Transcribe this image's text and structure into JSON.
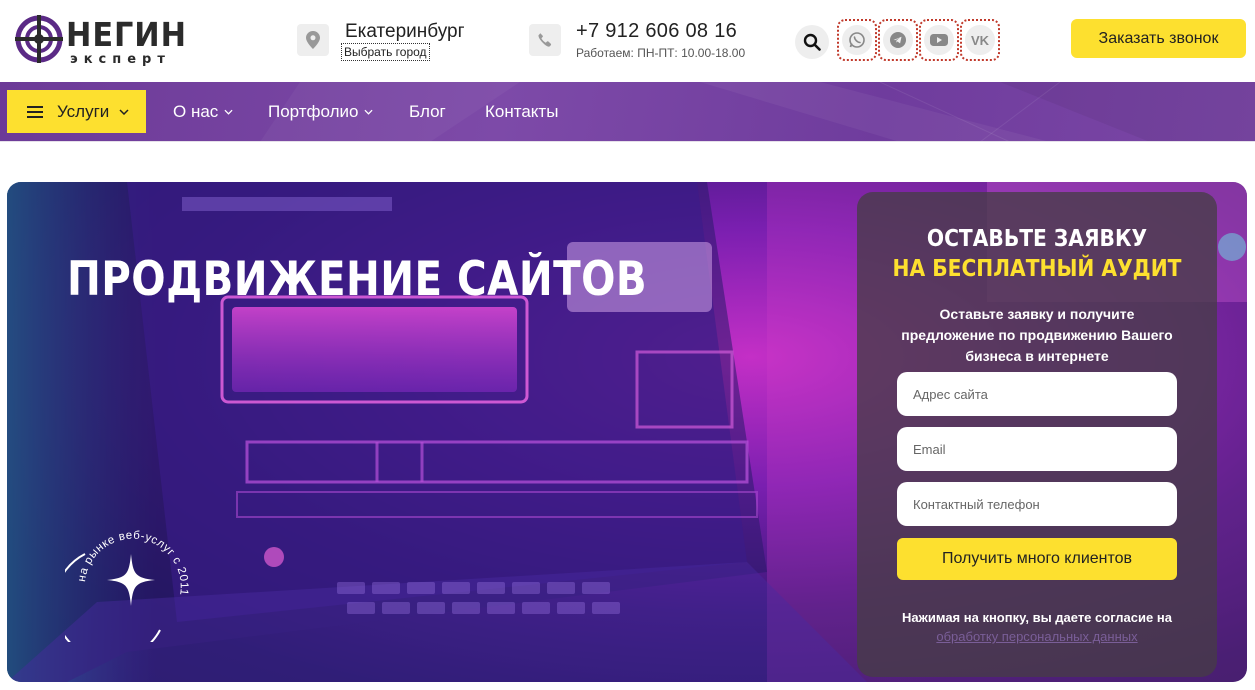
{
  "logo": {
    "word": "НЕГИН",
    "sub": "эксперт"
  },
  "location": {
    "city": "Екатеринбург",
    "change_label": "Выбрать город",
    "icon": "map-pin-icon"
  },
  "contact": {
    "phone": "+7 912 606 08 16",
    "hours": "Работаем: ПН-ПТ: 10.00-18.00",
    "icon": "phone-icon"
  },
  "socials": [
    "whatsapp-icon",
    "telegram-icon",
    "youtube-icon",
    "vk-icon"
  ],
  "callback_label": "Заказать звонок",
  "nav": {
    "services_label": "Услуги",
    "items": [
      {
        "label": "О нас",
        "has_dropdown": true
      },
      {
        "label": "Портфолио",
        "has_dropdown": true
      },
      {
        "label": "Блог",
        "has_dropdown": false
      },
      {
        "label": "Контакты",
        "has_dropdown": false
      }
    ]
  },
  "hero": {
    "title": "ПРОДВИЖЕНИЕ САЙТОВ",
    "badge_text": "на рынке веб-услуг с 2011"
  },
  "form": {
    "title_line1": "ОСТАВЬТЕ ЗАЯВКУ",
    "title_line2": "НА БЕСПЛАТНЫЙ АУДИТ",
    "description": "Оставьте заявку и получите предложение по продвижению Вашего бизнеса в интернете",
    "site_placeholder": "Адрес сайта",
    "email_placeholder": "Email",
    "phone_placeholder": "Контактный телефон",
    "submit_label": "Получить много клиентов",
    "consent_text": "Нажимая на кнопку, вы даете согласие на",
    "consent_link": "обработку персональных данных"
  },
  "colors": {
    "accent_yellow": "#fde02f",
    "nav_purple": "#7440a0"
  }
}
